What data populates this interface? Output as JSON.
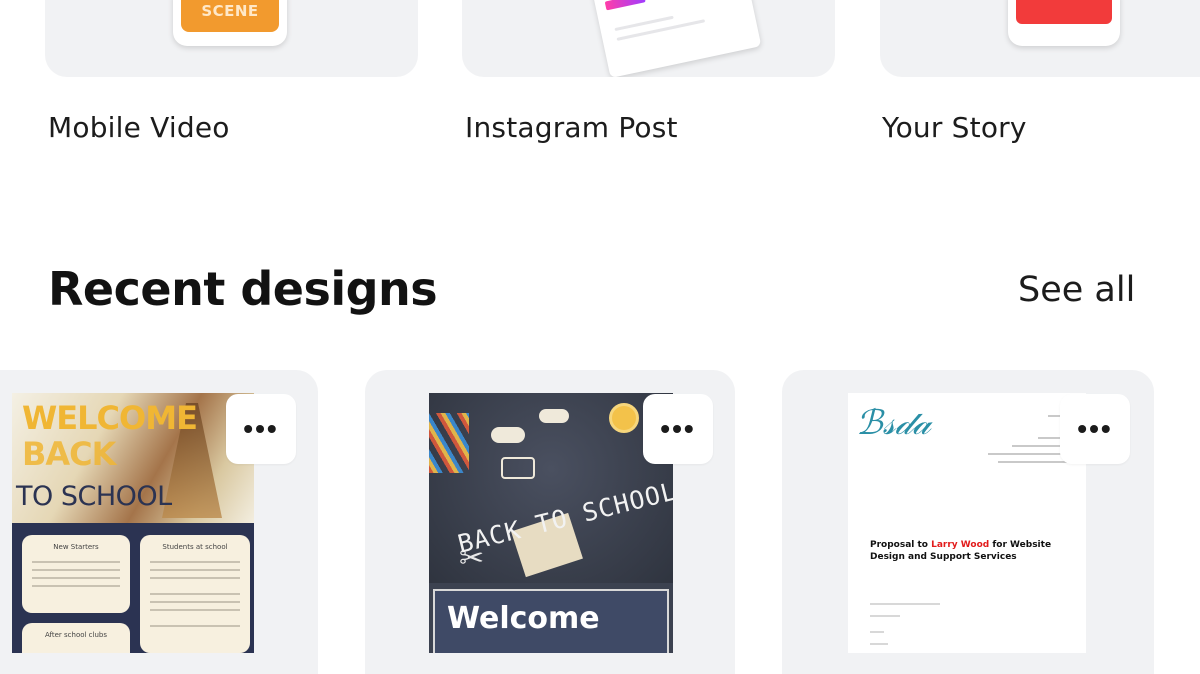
{
  "templates": [
    {
      "label": "Mobile Video",
      "thumb_text": "SCENE",
      "accent": "#f29a2e"
    },
    {
      "label": "Instagram Post",
      "accent": "#ff3da8"
    },
    {
      "label": "Your Story",
      "accent": "#f23b3b"
    }
  ],
  "recent": {
    "title": "Recent designs",
    "see_all": "See all",
    "more_label": "•••",
    "cards": [
      {
        "lines": [
          "WELCOME",
          "BACK",
          "TO SCHOOL"
        ],
        "boxes": [
          "New Starters",
          "Students at school",
          "After school clubs"
        ]
      },
      {
        "chalk": "BACK TO SCHOOL",
        "welcome": "Welcome"
      },
      {
        "proposal_prefix": "Proposal to",
        "proposal_highlight": "Larry Wood",
        "proposal_suffix": "for Website Design and Support Services"
      }
    ]
  }
}
